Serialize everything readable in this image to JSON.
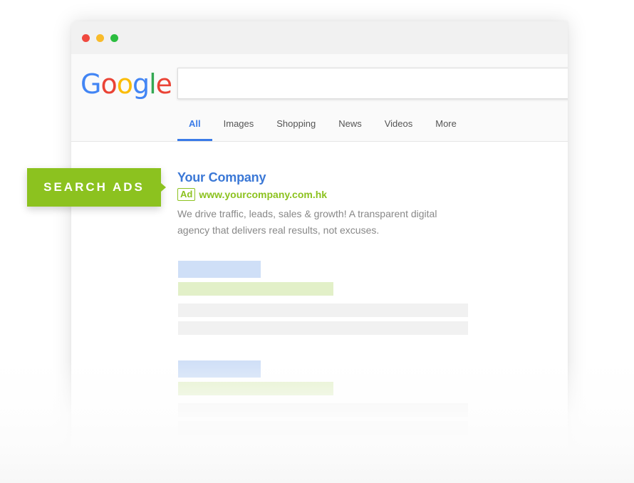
{
  "browser": {
    "dots": [
      "red",
      "yellow",
      "green"
    ]
  },
  "logo": {
    "letters": [
      {
        "char": "G",
        "color": "#4285f4"
      },
      {
        "char": "o",
        "color": "#ea4335"
      },
      {
        "char": "o",
        "color": "#fbbc05"
      },
      {
        "char": "g",
        "color": "#4285f4"
      },
      {
        "char": "l",
        "color": "#34a853"
      },
      {
        "char": "e",
        "color": "#ea4335"
      }
    ]
  },
  "search": {
    "value": ""
  },
  "tabs": [
    "All",
    "Images",
    "Shopping",
    "News",
    "Videos",
    "More"
  ],
  "active_tab": "All",
  "result": {
    "title": "Your Company",
    "ad_badge": "Ad",
    "url": "www.yourcompany.com.hk",
    "description": "We drive traffic, leads, sales & growth! A transparent digital agency that delivers real results, not excuses."
  },
  "callout": {
    "label": "SEARCH ADS"
  },
  "colors": {
    "accent_green": "#8cc21f",
    "link_blue": "#3b78d6",
    "tab_active": "#3a7be8"
  }
}
